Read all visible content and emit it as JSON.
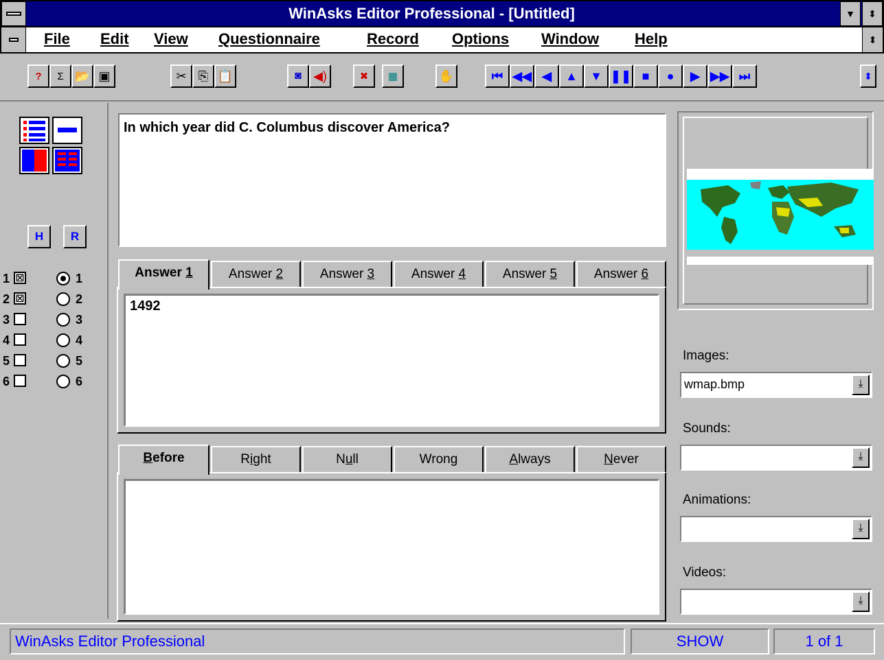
{
  "window": {
    "title": "WinAsks Editor Professional - [Untitled]"
  },
  "menu": {
    "items": [
      "File",
      "Edit",
      "View",
      "Questionnaire",
      "Record",
      "Options",
      "Window",
      "Help"
    ]
  },
  "toolbar": {
    "file_buttons": [
      "new-question-icon",
      "new-sum-icon",
      "open-folder-icon",
      "save-icon"
    ],
    "edit_buttons": [
      "cut-icon",
      "copy-icon",
      "paste-icon"
    ],
    "media_buttons": [
      "camera-icon",
      "speaker-icon",
      "sound-off-icon",
      "video-icon"
    ],
    "hand_button": "hand-icon",
    "nav_buttons": [
      "first-icon",
      "rewind-icon",
      "prev-icon",
      "up-icon",
      "down-icon",
      "pause-icon",
      "stop-icon",
      "record-icon",
      "play-icon",
      "fast-forward-icon",
      "last-icon"
    ]
  },
  "left_panel": {
    "h_label": "H",
    "r_label": "R",
    "options": [
      {
        "num": "1",
        "checked": true,
        "radio_selected": true,
        "rnum": "1"
      },
      {
        "num": "2",
        "checked": true,
        "radio_selected": false,
        "rnum": "2"
      },
      {
        "num": "3",
        "checked": false,
        "radio_selected": false,
        "rnum": "3"
      },
      {
        "num": "4",
        "checked": false,
        "radio_selected": false,
        "rnum": "4"
      },
      {
        "num": "5",
        "checked": false,
        "radio_selected": false,
        "rnum": "5"
      },
      {
        "num": "6",
        "checked": false,
        "radio_selected": false,
        "rnum": "6"
      }
    ],
    "check_mark": "☒"
  },
  "question": {
    "text": "In which year did C. Columbus discover America?"
  },
  "answer_tabs": {
    "tabs": [
      {
        "pre": "Answer ",
        "key": "1"
      },
      {
        "pre": "Answer ",
        "key": "2"
      },
      {
        "pre": "Answer ",
        "key": "3"
      },
      {
        "pre": "Answer ",
        "key": "4"
      },
      {
        "pre": "Answer ",
        "key": "5"
      },
      {
        "pre": "Answer ",
        "key": "6"
      }
    ],
    "active_index": 0,
    "content": "1492"
  },
  "feedback_tabs": {
    "tabs": [
      {
        "key": "B",
        "rest": "efore"
      },
      {
        "pre": "R",
        "key": "i",
        "rest": "ght"
      },
      {
        "pre": "N",
        "key": "u",
        "rest": "ll"
      },
      {
        "pre": "Wron",
        "key": "g",
        "rest": ""
      },
      {
        "key": "A",
        "rest": "lways"
      },
      {
        "key": "N",
        "rest": "ever"
      }
    ],
    "active_index": 0,
    "content": ""
  },
  "media": {
    "images_label": "Images:",
    "images_value": "wmap.bmp",
    "sounds_label": "Sounds:",
    "sounds_value": "",
    "animations_label": "Animations:",
    "animations_value": "",
    "videos_label": "Videos:",
    "videos_value": ""
  },
  "status": {
    "app": "WinAsks Editor Professional",
    "mode": "SHOW",
    "position": "1 of 1"
  }
}
